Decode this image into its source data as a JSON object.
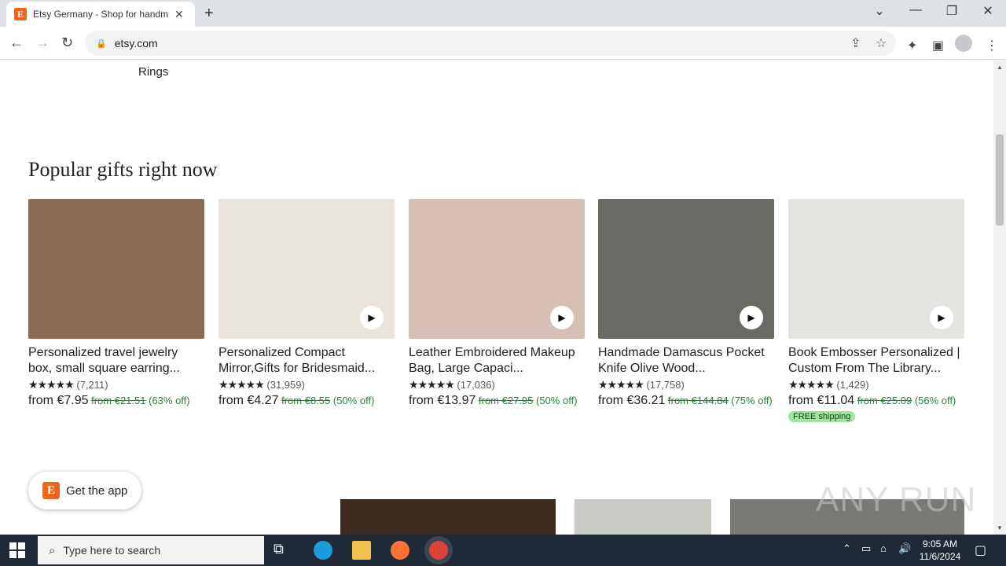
{
  "browser": {
    "tab_title": "Etsy Germany - Shop for handmade",
    "tab_favicon": "E",
    "url": "etsy.com"
  },
  "page": {
    "prev_section_label": "Rings",
    "section_title": "Popular gifts right now",
    "products": [
      {
        "title": "Personalized travel jewelry box, small square earring...",
        "stars": "★★★★★",
        "reviews": "(7,211)",
        "price": "from €7.95",
        "original_price": "from €21.51",
        "discount": "(63% off)",
        "has_video": false,
        "free_shipping": "",
        "image_color": "#8a6a52"
      },
      {
        "title": "Personalized Compact Mirror,Gifts for Bridesmaid...",
        "stars": "★★★★★",
        "reviews": "(31,959)",
        "price": "from €4.27",
        "original_price": "from €8.55",
        "discount": "(50% off)",
        "has_video": true,
        "free_shipping": "",
        "image_color": "#e9e4dc"
      },
      {
        "title": "Leather Embroidered Makeup Bag, Large Capaci...",
        "stars": "★★★★★",
        "reviews": "(17,036)",
        "price": "from €13.97",
        "original_price": "from €27.95",
        "discount": "(50% off)",
        "has_video": true,
        "free_shipping": "",
        "image_color": "#d8bfb6"
      },
      {
        "title": "Handmade Damascus Pocket Knife Olive Wood...",
        "stars": "★★★★★",
        "reviews": "(17,758)",
        "price": "from €36.21",
        "original_price": "from €144.84",
        "discount": "(75% off)",
        "has_video": true,
        "free_shipping": "",
        "image_color": "#6b6a64"
      },
      {
        "title": "Book Embosser Personalized | Custom From The Library...",
        "stars": "★★★★★",
        "reviews": "(1,429)",
        "price": "from €11.04",
        "original_price": "from €25.09",
        "discount": "(56% off)",
        "has_video": true,
        "free_shipping": "FREE shipping",
        "image_color": "#e6e4e1"
      }
    ],
    "get_app_label": "Get the app",
    "watermark": "ANY RUN"
  },
  "taskbar": {
    "search_placeholder": "Type here to search",
    "time": "9:05 AM",
    "date": "11/6/2024"
  },
  "colors": {
    "etsy_orange": "#f1641e",
    "discount_green": "#258635",
    "free_shipping_bg": "#9ee69e",
    "taskbar_bg": "#1f2a36"
  }
}
